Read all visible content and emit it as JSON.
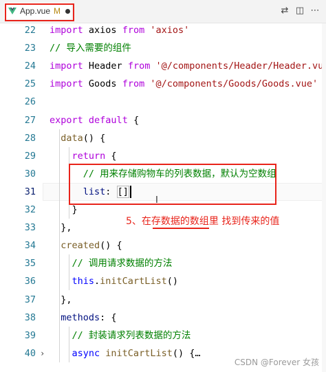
{
  "tab": {
    "filename": "App.vue",
    "status": "M",
    "icon": "vue-icon"
  },
  "actions": [
    "compare-changes-icon",
    "split-editor-icon",
    "more-actions-icon"
  ],
  "code": [
    {
      "n": "22",
      "tokens": [
        {
          "t": "import",
          "c": "kw"
        },
        {
          "t": " axios ",
          "c": "plain"
        },
        {
          "t": "from",
          "c": "kw"
        },
        {
          "t": " 'axios'",
          "c": "str"
        }
      ]
    },
    {
      "n": "23",
      "tokens": [
        {
          "t": "// 导入需要的组件",
          "c": "com"
        }
      ]
    },
    {
      "n": "24",
      "tokens": [
        {
          "t": "import",
          "c": "kw"
        },
        {
          "t": " Header ",
          "c": "plain"
        },
        {
          "t": "from",
          "c": "kw"
        },
        {
          "t": " '@/components/Header/Header.vue'",
          "c": "str"
        }
      ]
    },
    {
      "n": "25",
      "tokens": [
        {
          "t": "import",
          "c": "kw"
        },
        {
          "t": " Goods ",
          "c": "plain"
        },
        {
          "t": "from",
          "c": "kw"
        },
        {
          "t": " '@/components/Goods/Goods.vue'",
          "c": "str"
        }
      ]
    },
    {
      "n": "26",
      "tokens": []
    },
    {
      "n": "27",
      "tokens": [
        {
          "t": "export",
          "c": "kw"
        },
        {
          "t": " ",
          "c": "plain"
        },
        {
          "t": "default",
          "c": "kw"
        },
        {
          "t": " {",
          "c": "plain"
        }
      ]
    },
    {
      "n": "28",
      "tokens": [
        {
          "t": "  ",
          "c": "plain"
        },
        {
          "t": "data",
          "c": "fn"
        },
        {
          "t": "() {",
          "c": "plain"
        }
      ]
    },
    {
      "n": "29",
      "tokens": [
        {
          "t": "    ",
          "c": "plain"
        },
        {
          "t": "return",
          "c": "kw"
        },
        {
          "t": " {",
          "c": "plain"
        }
      ]
    },
    {
      "n": "30",
      "tokens": [
        {
          "t": "      ",
          "c": "plain"
        },
        {
          "t": "// 用来存储购物车的列表数据，默认为空数组",
          "c": "com"
        }
      ]
    },
    {
      "n": "31",
      "tokens": [
        {
          "t": "      ",
          "c": "plain"
        },
        {
          "t": "list",
          "c": "var"
        },
        {
          "t": ": ",
          "c": "plain"
        },
        {
          "t": "[]",
          "c": "bracket"
        },
        {
          "t": "",
          "c": "cursor"
        }
      ],
      "active": true
    },
    {
      "n": "32",
      "tokens": [
        {
          "t": "    }",
          "c": "plain"
        }
      ]
    },
    {
      "n": "33",
      "tokens": [
        {
          "t": "  },",
          "c": "plain"
        }
      ]
    },
    {
      "n": "34",
      "tokens": [
        {
          "t": "  ",
          "c": "plain"
        },
        {
          "t": "created",
          "c": "fn"
        },
        {
          "t": "() {",
          "c": "plain"
        }
      ]
    },
    {
      "n": "35",
      "tokens": [
        {
          "t": "    ",
          "c": "plain"
        },
        {
          "t": "// 调用请求数据的方法",
          "c": "com"
        }
      ]
    },
    {
      "n": "36",
      "tokens": [
        {
          "t": "    ",
          "c": "plain"
        },
        {
          "t": "this",
          "c": "blue"
        },
        {
          "t": ".",
          "c": "plain"
        },
        {
          "t": "initCartList",
          "c": "fn"
        },
        {
          "t": "()",
          "c": "plain"
        }
      ]
    },
    {
      "n": "37",
      "tokens": [
        {
          "t": "  },",
          "c": "plain"
        }
      ]
    },
    {
      "n": "38",
      "tokens": [
        {
          "t": "  ",
          "c": "plain"
        },
        {
          "t": "methods",
          "c": "var"
        },
        {
          "t": ": {",
          "c": "plain"
        }
      ]
    },
    {
      "n": "39",
      "tokens": [
        {
          "t": "    ",
          "c": "plain"
        },
        {
          "t": "// 封装请求列表数据的方法",
          "c": "com"
        }
      ]
    },
    {
      "n": "40",
      "tokens": [
        {
          "t": "    ",
          "c": "plain"
        },
        {
          "t": "async",
          "c": "blue"
        },
        {
          "t": " ",
          "c": "plain"
        },
        {
          "t": "initCartList",
          "c": "fn"
        },
        {
          "t": "() {",
          "c": "plain"
        },
        {
          "t": "…",
          "c": "plain"
        }
      ],
      "fold": true
    }
  ],
  "annotation": {
    "text": "5、在存数据的数组里 找到传来的值"
  },
  "watermark": "CSDN @Forever 女孩",
  "colors": {
    "annotation": "#e8231a",
    "keyword": "#af00db",
    "string": "#a31515",
    "comment": "#008000",
    "function": "#795e26"
  }
}
